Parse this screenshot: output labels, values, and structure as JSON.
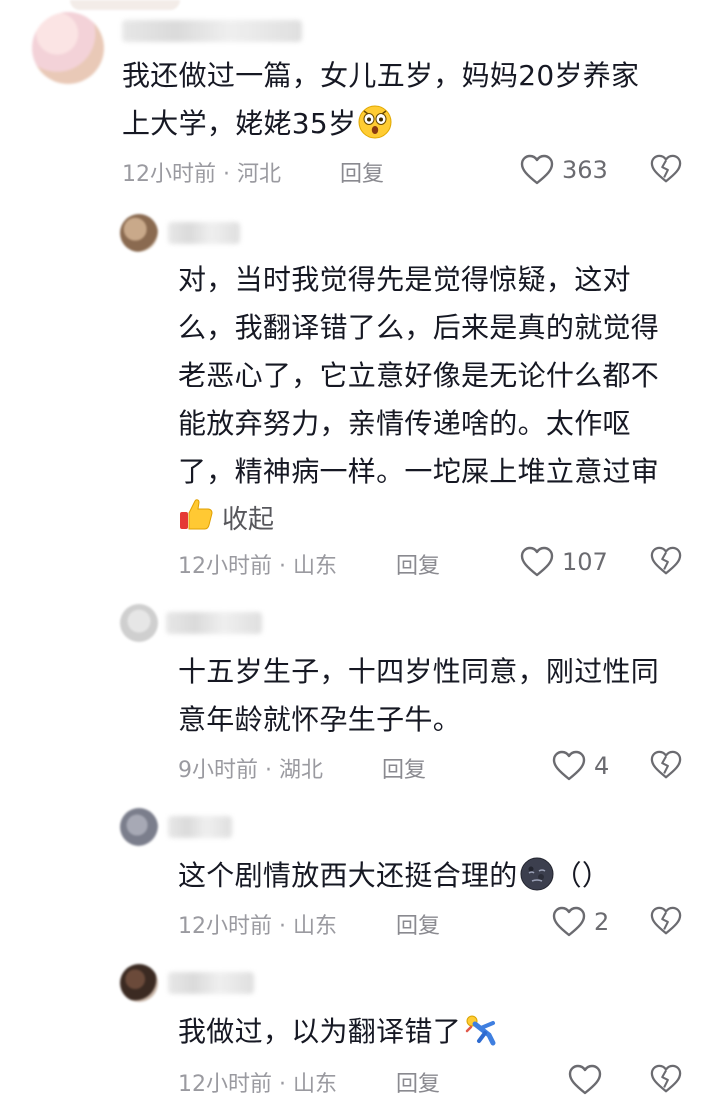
{
  "comments": [
    {
      "text_lines": [
        "我还做过一篇，女儿五岁，妈妈20岁养家",
        "上大学，姥姥35岁"
      ],
      "time": "12小时前",
      "location": "河北",
      "reply_label": "回复",
      "likes": "363",
      "emoji": "astonished-face-emoji"
    },
    {
      "text_lines": [
        "对，当时我觉得先是觉得惊疑，这对",
        "么，我翻译错了么，后来是真的就觉得",
        "老恶心了，它立意好像是无论什么都不",
        "能放弃努力，亲情传递啥的。太作呕",
        "了，精神病一样。一坨屎上堆立意过审"
      ],
      "collapse_label": "收起",
      "time": "12小时前",
      "location": "山东",
      "reply_label": "回复",
      "likes": "107",
      "emoji": "thumbs-up-emoji"
    },
    {
      "text_lines": [
        "十五岁生子，十四岁性同意，刚过性同",
        "意年龄就怀孕生子牛。"
      ],
      "time": "9小时前",
      "location": "湖北",
      "reply_label": "回复",
      "likes": "4"
    },
    {
      "text_lines": [
        "这个剧情放西大还挺合理的"
      ],
      "text_suffix": "（）",
      "time": "12小时前",
      "location": "山东",
      "reply_label": "回复",
      "likes": "2",
      "emoji": "new-moon-face-emoji"
    },
    {
      "text_lines": [
        "我做过，以为翻译错了"
      ],
      "time": "12小时前",
      "location": "山东",
      "reply_label": "回复",
      "likes": "",
      "emoji": "person-falling-emoji"
    }
  ],
  "meta_separator": "·",
  "colors": {
    "text": "#161823",
    "meta": "#9a9aa0",
    "icon": "#6b6b70",
    "background": "#ffffff"
  }
}
